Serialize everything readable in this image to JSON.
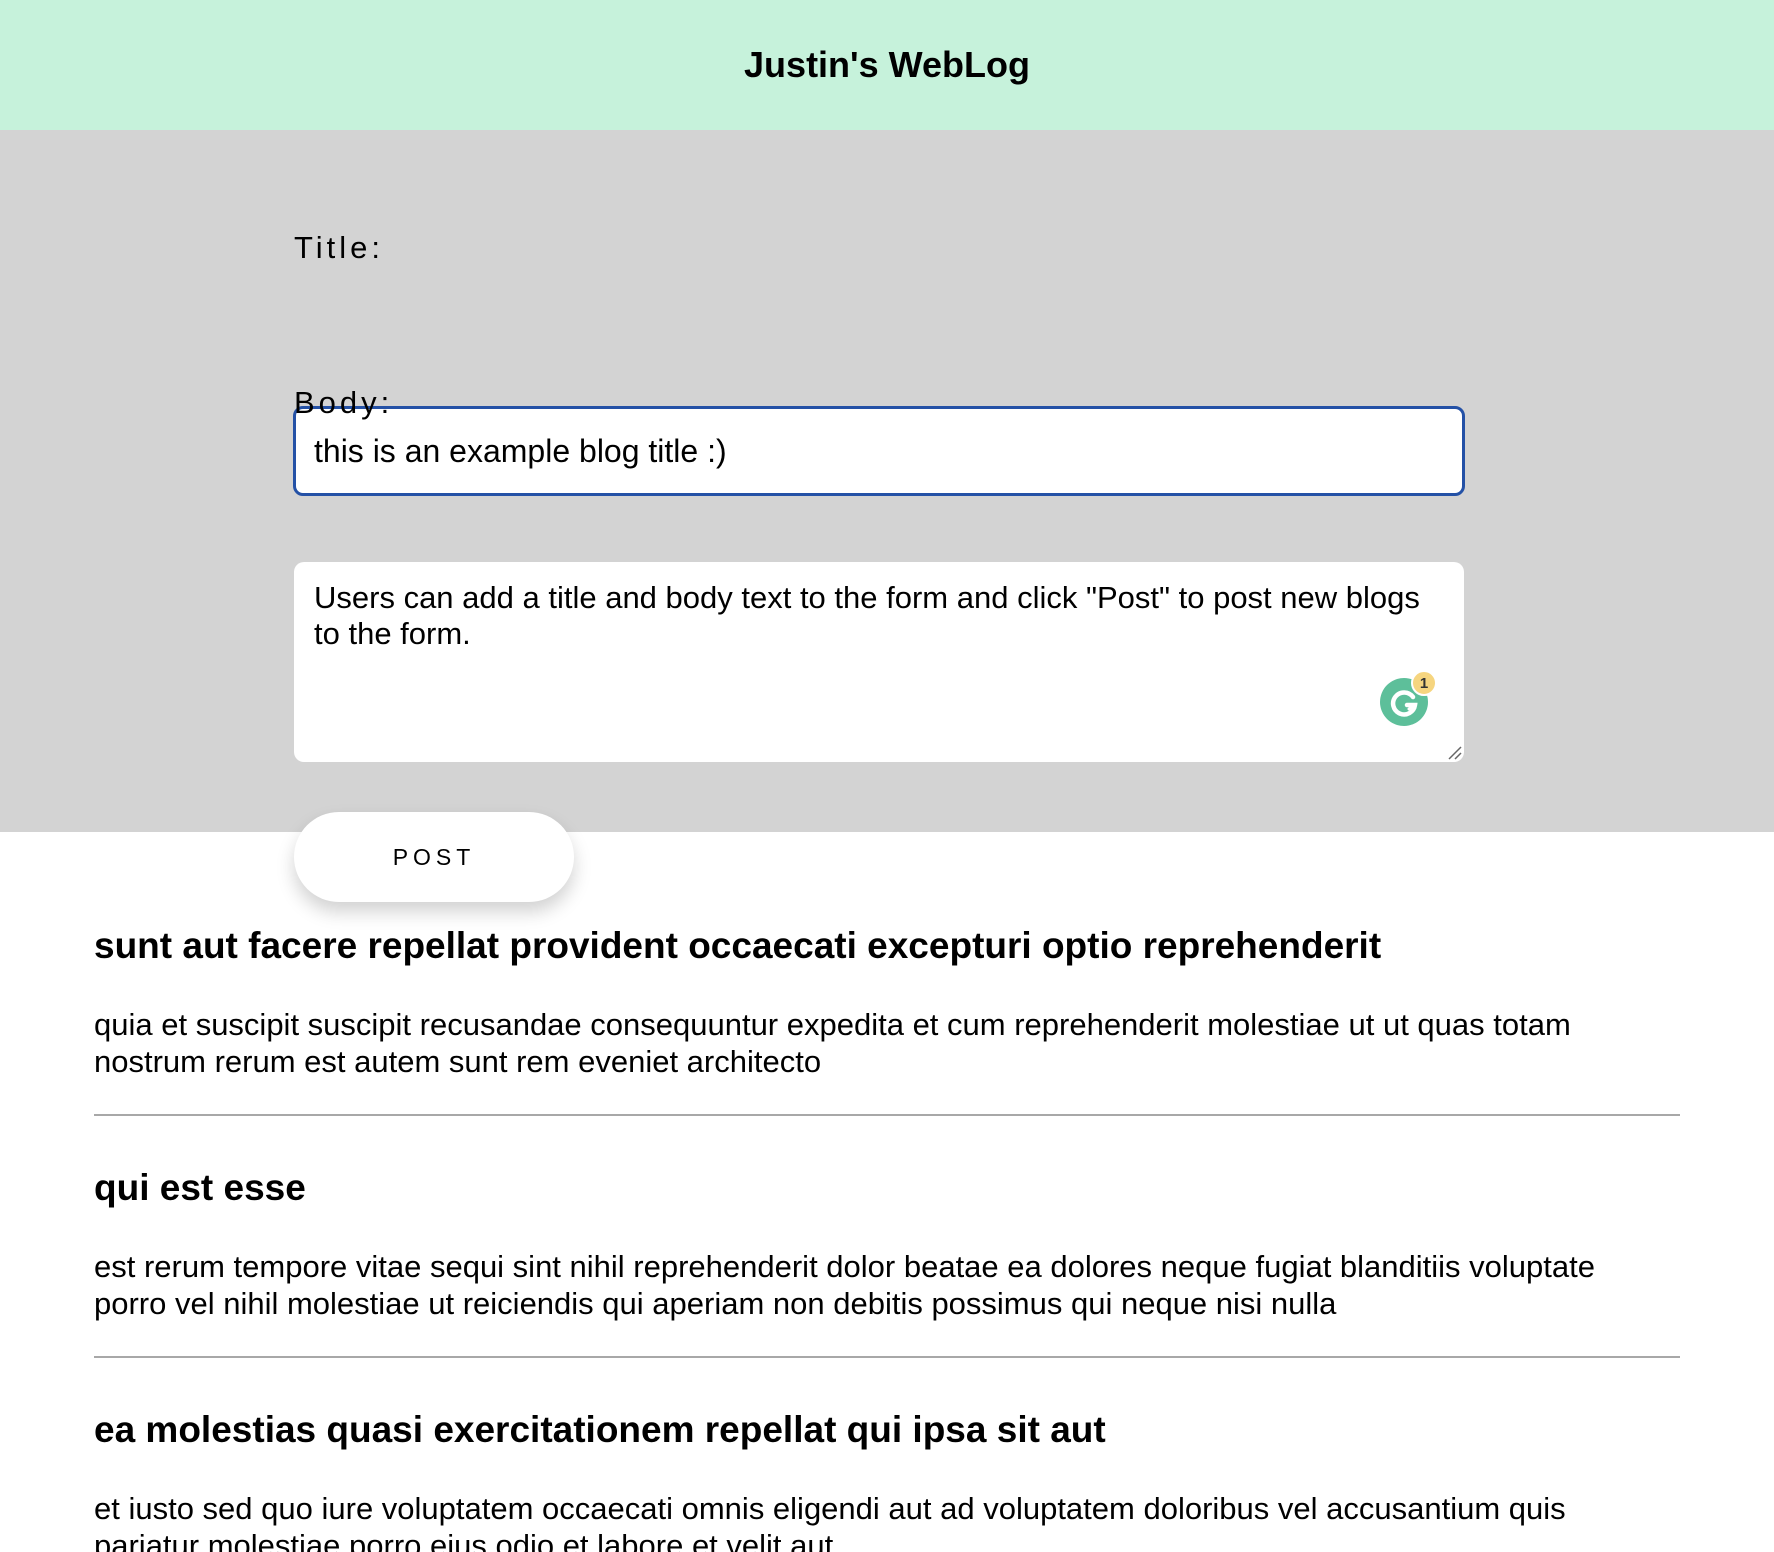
{
  "header": {
    "title": "Justin's WebLog"
  },
  "form": {
    "title_label": "Title:",
    "title_value": "this is an example blog title :)",
    "body_label": "Body:",
    "body_value": "Users can add a title and body text to the form and click \"Post\" to post new blogs to the form.",
    "post_button_label": "POST",
    "grammarly_count": "1"
  },
  "posts": [
    {
      "title": "sunt aut facere repellat provident occaecati excepturi optio reprehenderit",
      "body": "quia et suscipit suscipit recusandae consequuntur expedita et cum reprehenderit molestiae ut ut quas totam nostrum rerum est autem sunt rem eveniet architecto"
    },
    {
      "title": "qui est esse",
      "body": "est rerum tempore vitae sequi sint nihil reprehenderit dolor beatae ea dolores neque fugiat blanditiis voluptate porro vel nihil molestiae ut reiciendis qui aperiam non debitis possimus qui neque nisi nulla"
    },
    {
      "title": "ea molestias quasi exercitationem repellat qui ipsa sit aut",
      "body": "et iusto sed quo iure voluptatem occaecati omnis eligendi aut ad voluptatem doloribus vel accusantium quis pariatur molestiae porro eius odio et labore et velit aut"
    }
  ],
  "colors": {
    "header_bg": "#c6f2db",
    "form_bg": "#d3d3d3",
    "focus_border": "#2451a6"
  }
}
